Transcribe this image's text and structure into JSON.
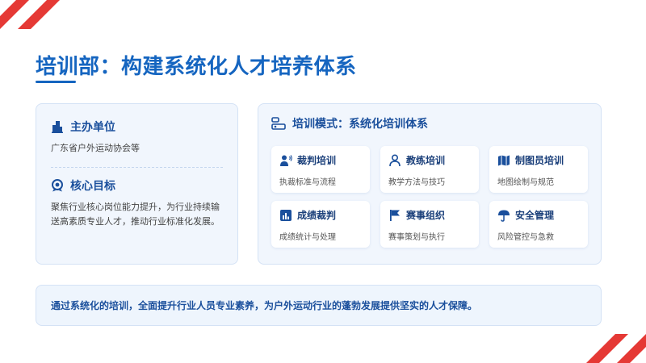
{
  "title": "培训部：构建系统化人才培养体系",
  "colors": {
    "accent": "#1565c0",
    "corner": "#e53935",
    "panel_bg": "#f1f6fd"
  },
  "left": {
    "host": {
      "icon": "building-icon",
      "label": "主办单位",
      "text": "广东省户外运动协会等"
    },
    "goal": {
      "icon": "target-icon",
      "label": "核心目标",
      "text": "聚焦行业核心岗位能力提升，为行业持续输送高素质专业人才，推动行业标准化发展。"
    }
  },
  "right": {
    "heading": {
      "icon": "training-mode-icon",
      "label": "培训模式：系统化培训体系"
    },
    "cards": [
      {
        "icon": "referee-icon",
        "title": "裁判培训",
        "desc": "执裁标准与流程"
      },
      {
        "icon": "coach-icon",
        "title": "教练培训",
        "desc": "教学方法与技巧"
      },
      {
        "icon": "map-icon",
        "title": "制图员培训",
        "desc": "地图绘制与规范"
      },
      {
        "icon": "chart-icon",
        "title": "成绩裁判",
        "desc": "成绩统计与处理"
      },
      {
        "icon": "flag-icon",
        "title": "赛事组织",
        "desc": "赛事策划与执行"
      },
      {
        "icon": "umbrella-icon",
        "title": "安全管理",
        "desc": "风险管控与急救"
      }
    ]
  },
  "footer": "通过系统化的培训，全面提升行业人员专业素养，为户外运动行业的蓬勃发展提供坚实的人才保障。"
}
